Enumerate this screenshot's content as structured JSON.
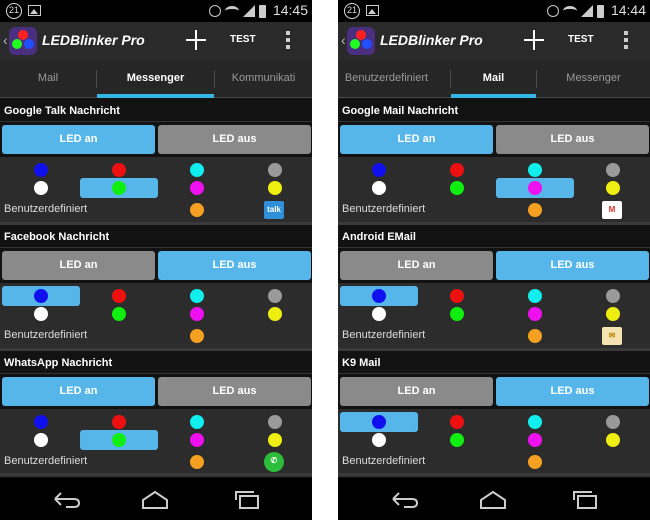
{
  "screens": [
    {
      "status": {
        "notification_count": "21",
        "time": "14:45"
      },
      "app_title": "LEDBlinker Pro",
      "test_label": "TEST",
      "tabs": [
        {
          "label": "Mail",
          "active": false
        },
        {
          "label": "Messenger",
          "active": true
        },
        {
          "label": "Kommunikati",
          "active": false
        }
      ],
      "sections": [
        {
          "title": "Google Talk Nachricht",
          "led_on": "LED an",
          "led_off": "LED aus",
          "led_on_active": true,
          "selected_color": "green",
          "custom_label": "Benutzerdefiniert",
          "app_icon": "talk-icon",
          "app_icon_text": "talk"
        },
        {
          "title": "Facebook Nachricht",
          "led_on": "LED an",
          "led_off": "LED aus",
          "led_on_active": false,
          "selected_color": "blue",
          "custom_label": "Benutzerdefiniert",
          "app_icon": "none"
        },
        {
          "title": "WhatsApp Nachricht",
          "led_on": "LED an",
          "led_off": "LED aus",
          "led_on_active": true,
          "selected_color": "green",
          "custom_label": "Benutzerdefiniert",
          "app_icon": "whatsapp-icon"
        }
      ]
    },
    {
      "status": {
        "notification_count": "21",
        "time": "14:44"
      },
      "app_title": "LEDBlinker Pro",
      "test_label": "TEST",
      "tabs": [
        {
          "label": "Benutzerdefiniert",
          "active": false
        },
        {
          "label": "Mail",
          "active": true
        },
        {
          "label": "Messenger",
          "active": false
        }
      ],
      "sections": [
        {
          "title": "Google Mail Nachricht",
          "led_on": "LED an",
          "led_off": "LED aus",
          "led_on_active": true,
          "selected_color": "magenta",
          "custom_label": "Benutzerdefiniert",
          "app_icon": "gmail-icon"
        },
        {
          "title": "Android EMail",
          "led_on": "LED an",
          "led_off": "LED aus",
          "led_on_active": false,
          "selected_color": "blue",
          "custom_label": "Benutzerdefiniert",
          "app_icon": "email-icon"
        },
        {
          "title": "K9 Mail",
          "led_on": "LED an",
          "led_off": "LED aus",
          "led_on_active": false,
          "selected_color": "blue",
          "custom_label": "Benutzerdefiniert",
          "app_icon": "none"
        }
      ]
    }
  ],
  "led_colors": [
    {
      "name": "blue",
      "hex": "#1010ee"
    },
    {
      "name": "red",
      "hex": "#ee1010"
    },
    {
      "name": "cyan",
      "hex": "#10eeee"
    },
    {
      "name": "gray",
      "hex": "#9a9a9a"
    },
    {
      "name": "white",
      "hex": "#ffffff"
    },
    {
      "name": "green",
      "hex": "#10ee10"
    },
    {
      "name": "magenta",
      "hex": "#ee10ee"
    },
    {
      "name": "yellow",
      "hex": "#eeee10"
    },
    {
      "name": "orange",
      "hex": "#f5a020"
    }
  ],
  "theme": {
    "accent": "#33b5e5",
    "button_active": "#56b6ea",
    "button_inactive": "#8a8a8a"
  }
}
